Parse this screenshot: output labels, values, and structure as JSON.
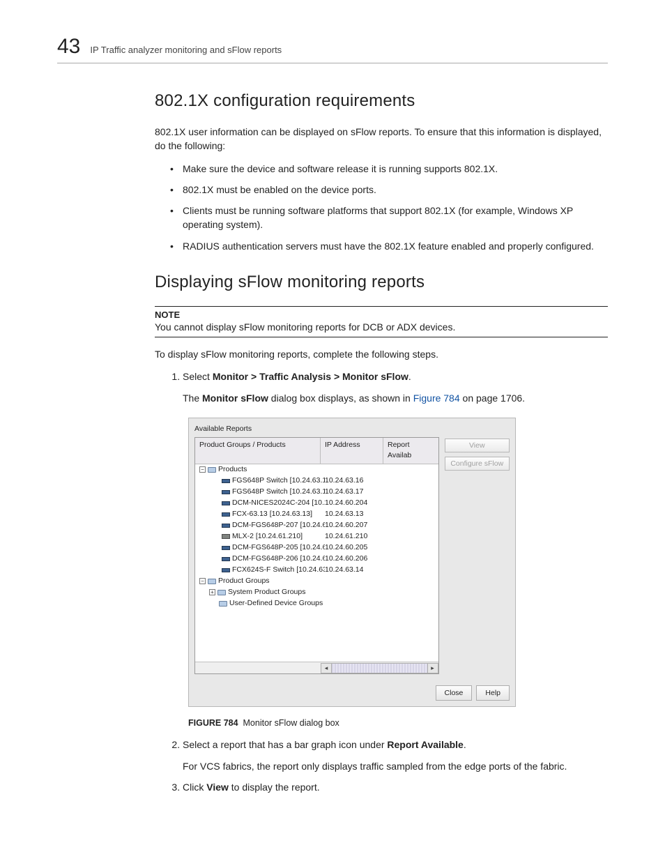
{
  "header": {
    "chapter": "43",
    "running": "IP Traffic analyzer monitoring and sFlow reports"
  },
  "s1": {
    "title": "802.1X configuration requirements",
    "intro": "802.1X user information can be displayed on sFlow reports. To ensure that this information is displayed, do the following:",
    "bullets": [
      "Make sure the device and software release it is running supports 802.1X.",
      "802.1X must be enabled on the device ports.",
      "Clients must be running software platforms that support 802.1X (for example, Windows XP operating system).",
      "RADIUS authentication servers must have the 802.1X feature enabled and properly configured."
    ]
  },
  "s2": {
    "title": "Displaying sFlow monitoring reports",
    "note_label": "NOTE",
    "note_text": "You cannot display sFlow monitoring reports for DCB or ADX devices.",
    "after_note": "To display sFlow monitoring reports, complete the following steps.",
    "step1_a": "Select ",
    "step1_b": "Monitor > Traffic Analysis > Monitor sFlow",
    "step1_c": ".",
    "step1_body_a": "The ",
    "step1_body_b": "Monitor sFlow",
    "step1_body_c": " dialog box displays, as shown in ",
    "step1_body_link": "Figure 784",
    "step1_body_d": " on page 1706.",
    "step2_a": "Select a report that has a bar graph icon under ",
    "step2_b": "Report Available",
    "step2_c": ".",
    "step2_body": "For VCS fabrics, the report only displays traffic sampled from the edge ports of the fabric.",
    "step3_a": "Click ",
    "step3_b": "View",
    "step3_c": " to display the report."
  },
  "dialog": {
    "panel_title": "Available Reports",
    "cols": [
      "Product Groups / Products",
      "IP Address",
      "Report Availab"
    ],
    "root_products": "Products",
    "products": [
      {
        "label": "FGS648P Switch [10.24.63.1",
        "ip": "10.24.63.16"
      },
      {
        "label": "FGS648P Switch [10.24.63.1",
        "ip": "10.24.63.17"
      },
      {
        "label": "DCM-NICES2024C-204 [10.24",
        "ip": "10.24.60.204"
      },
      {
        "label": "FCX-63.13 [10.24.63.13]",
        "ip": "10.24.63.13"
      },
      {
        "label": "DCM-FGS648P-207 [10.24.60",
        "ip": "10.24.60.207"
      },
      {
        "label": "MLX-2 [10.24.61.210]",
        "ip": "10.24.61.210",
        "alt": true
      },
      {
        "label": "DCM-FGS648P-205 [10.24.60",
        "ip": "10.24.60.205"
      },
      {
        "label": "DCM-FGS648P-206 [10.24.60",
        "ip": "10.24.60.206"
      },
      {
        "label": "FCX624S-F Switch [10.24.63",
        "ip": "10.24.63.14"
      }
    ],
    "root_groups": "Product Groups",
    "groups": [
      {
        "label": "System Product Groups",
        "expandable": true
      },
      {
        "label": "User-Defined Device Groups",
        "expandable": false
      }
    ],
    "btn_view": "View",
    "btn_cfg": "Configure sFlow",
    "btn_close": "Close",
    "btn_help": "Help"
  },
  "figure": {
    "num": "FIGURE 784",
    "caption": "Monitor sFlow dialog box"
  }
}
